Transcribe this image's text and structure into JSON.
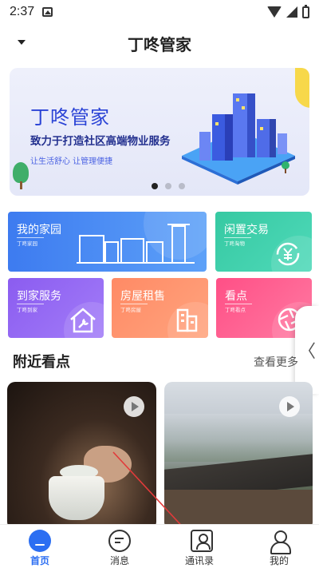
{
  "status_bar": {
    "time": "2:37"
  },
  "header": {
    "title": "丁咚管家"
  },
  "banner": {
    "headline": "丁咚管家",
    "slogan": "致力于打造社区高端物业服务",
    "tagline": "让生活舒心 让管理便捷",
    "page_indicator": {
      "count": 3,
      "active_index": 0
    }
  },
  "tiles": {
    "home": {
      "title": "我的家园",
      "sub": "丁咚家园"
    },
    "trade": {
      "title": "闲置交易",
      "sub": "丁咚淘物"
    },
    "service": {
      "title": "到家服务",
      "sub": "丁咚到家"
    },
    "rent": {
      "title": "房屋租售",
      "sub": "丁咚房屋"
    },
    "spots": {
      "title": "看点",
      "sub": "丁咚看点"
    }
  },
  "side_handle": {
    "glyph": "〈"
  },
  "nearby": {
    "title": "附近看点",
    "see_more": "查看更多"
  },
  "tabbar": {
    "items": [
      {
        "label": "首页",
        "icon": "home-icon",
        "active": true
      },
      {
        "label": "消息",
        "icon": "message-icon",
        "active": false
      },
      {
        "label": "通讯录",
        "icon": "contacts-icon",
        "active": false
      },
      {
        "label": "我的",
        "icon": "user-icon",
        "active": false
      }
    ]
  },
  "colors": {
    "accent": "#2b6ef2",
    "tile_home": "#3d7bf0",
    "tile_trade": "#36c9a2",
    "tile_service": "#8b5cf0",
    "tile_rent": "#ff8a65",
    "tile_spots": "#ff4f86",
    "annotation_arrow": "#e23a3a"
  }
}
